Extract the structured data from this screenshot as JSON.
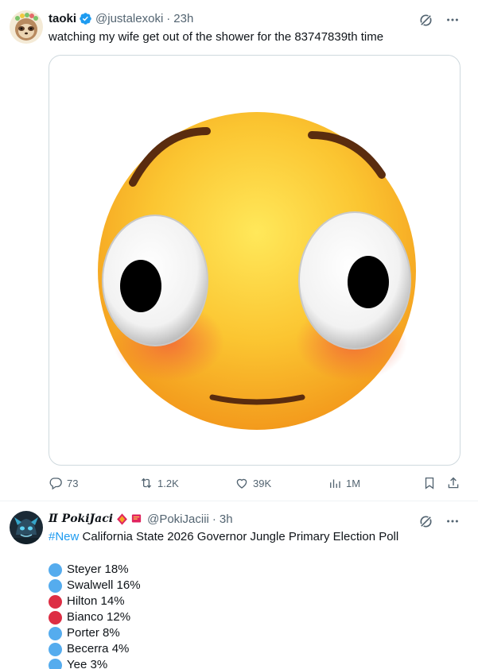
{
  "colors": {
    "link": "#1d9bf0",
    "muted": "#536471",
    "text": "#0f1419",
    "dem_blue": "#55acee",
    "rep_red": "#dd2e44",
    "verified": "#1d9bf0",
    "affiliate_red": "#e0245e"
  },
  "tweet1": {
    "name": "taoki",
    "handle": "@justalexoki",
    "separator": "·",
    "time": "23h",
    "text": "watching my wife get out of the shower for the 83747839th time",
    "media": {
      "icon": "flushed-face-emoji"
    },
    "stats": {
      "replies": "73",
      "reposts": "1.2K",
      "likes": "39K",
      "views": "1M"
    }
  },
  "tweet2": {
    "name": "Ⅱ 𝑷𝒐𝒌𝒊𝑱𝒂𝒄𝒊",
    "handle": "@PokiJaciii",
    "separator": "·",
    "time": "3h",
    "hashtag": "#New",
    "text": " California State 2026 Governor Jungle Primary Election Poll",
    "poll": [
      {
        "label": "Steyer 18%",
        "party": "blue"
      },
      {
        "label": "Swalwell 16%",
        "party": "blue"
      },
      {
        "label": "Hilton 14%",
        "party": "red"
      },
      {
        "label": "Bianco 12%",
        "party": "red"
      },
      {
        "label": "Porter 8%",
        "party": "blue"
      },
      {
        "label": "Becerra 4%",
        "party": "blue"
      },
      {
        "label": "Yee 3%",
        "party": "blue"
      }
    ]
  }
}
